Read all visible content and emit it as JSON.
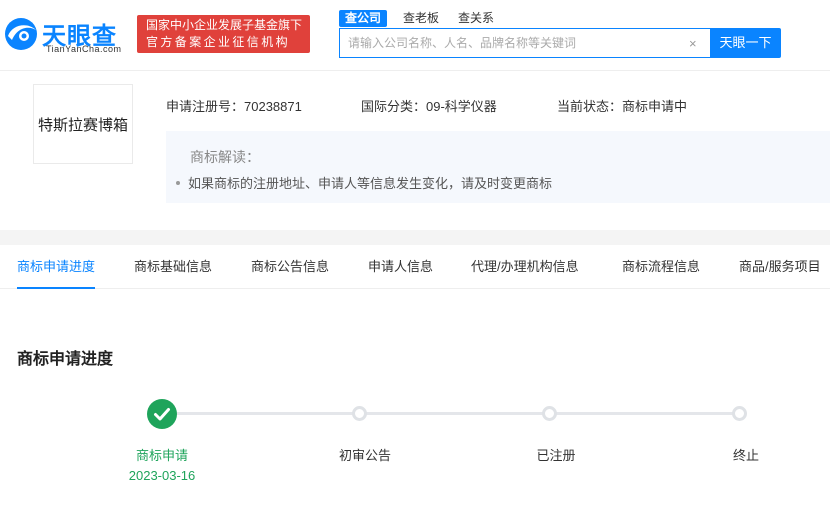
{
  "header": {
    "logo_cn": "天眼查",
    "logo_en": "TianYanCha.com",
    "promo_line1": "国家中小企业发展子基金旗下",
    "promo_line2": "官方备案企业征信机构",
    "search_tabs": [
      "查公司",
      "查老板",
      "查关系"
    ],
    "search_placeholder": "请输入公司名称、人名、品牌名称等关键词",
    "clear_symbol": "×",
    "search_button": "天眼一下"
  },
  "trademark": {
    "name": "特斯拉赛博箱",
    "reg_no_label": "申请注册号：",
    "reg_no": "70238871",
    "class_label": "国际分类：",
    "class_value": "09-科学仪器",
    "status_label": "当前状态：",
    "status_value": "商标申请中",
    "interpret_title": "商标解读：",
    "interpret_item": "如果商标的注册地址、申请人等信息发生变化，请及时变更商标"
  },
  "tabs": [
    "商标申请进度",
    "商标基础信息",
    "商标公告信息",
    "申请人信息",
    "代理/办理机构信息",
    "商标流程信息",
    "商品/服务项目"
  ],
  "progress": {
    "title": "商标申请进度",
    "steps": [
      {
        "label": "商标申请",
        "date": "2023-03-16",
        "done": true
      },
      {
        "label": "初审公告",
        "done": false
      },
      {
        "label": "已注册",
        "done": false
      },
      {
        "label": "终止",
        "done": false
      }
    ]
  },
  "colors": {
    "accent": "#0a84ff",
    "success": "#1fa45b",
    "promo": "#e0413b"
  }
}
